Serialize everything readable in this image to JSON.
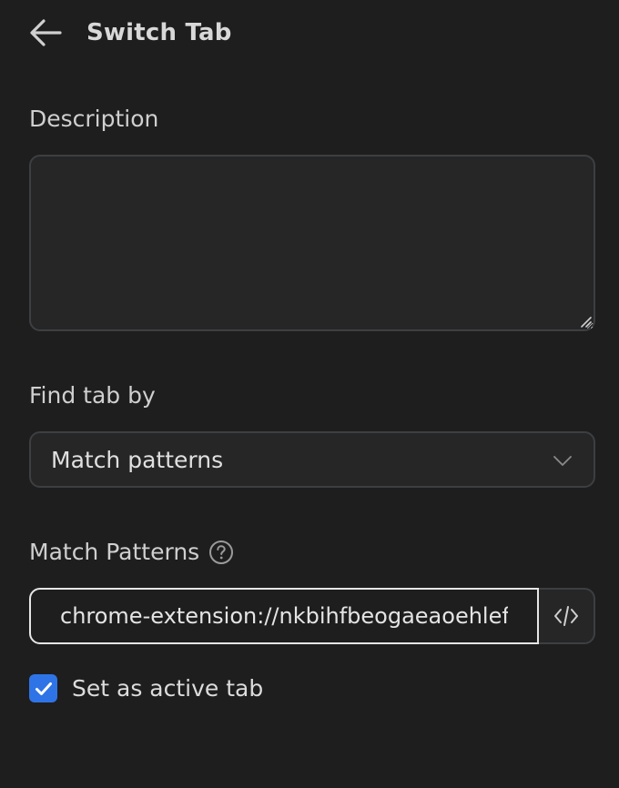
{
  "header": {
    "back_icon": "arrow-left-icon",
    "title": "Switch Tab"
  },
  "description": {
    "label": "Description",
    "value": "",
    "placeholder": ""
  },
  "find_tab_by": {
    "label": "Find tab by",
    "selected": "Match patterns",
    "dropdown_icon": "chevron-down-icon"
  },
  "match_patterns": {
    "label": "Match Patterns",
    "help_icon": "question-circle-icon",
    "value": "chrome-extension://nkbihfbeogaeaoehlefnkodbefgpgknn/*",
    "code_icon": "code-brackets-icon"
  },
  "active_tab": {
    "label": "Set as active tab",
    "checked": true,
    "check_color": "#2f74e6"
  }
}
